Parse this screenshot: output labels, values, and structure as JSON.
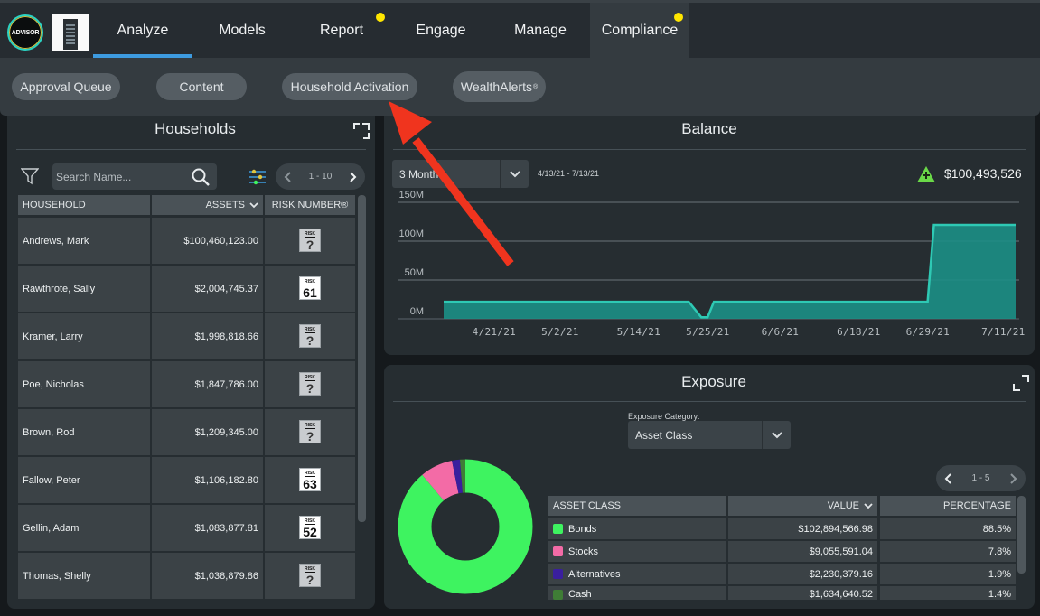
{
  "topbar": {
    "logo_text": "ADVISOR",
    "nav": [
      {
        "label": "Analyze",
        "active": true,
        "dot": false
      },
      {
        "label": "Models",
        "active": false,
        "dot": false
      },
      {
        "label": "Report",
        "active": false,
        "dot": true
      },
      {
        "label": "Engage",
        "active": false,
        "dot": false
      },
      {
        "label": "Manage",
        "active": false,
        "dot": false
      },
      {
        "label": "Compliance",
        "active": false,
        "dot": true,
        "selected": true
      }
    ],
    "dot_color": "#ffe600",
    "accent": "#3d9be0"
  },
  "subnav": {
    "pills": [
      "Approval Queue",
      "Content",
      "Household Activation",
      "WealthAlerts"
    ],
    "wealthalerts_mark": "®"
  },
  "households": {
    "title": "Households",
    "search_placeholder": "Search Name...",
    "pager": "1 - 10",
    "columns": [
      "HOUSEHOLD",
      "ASSETS",
      "RISK NUMBER®"
    ],
    "rows": [
      {
        "name": "Andrews, Mark",
        "assets": "$100,460,123.00",
        "risk": "?"
      },
      {
        "name": "Rawthrote, Sally",
        "assets": "$2,004,745.37",
        "risk": "61"
      },
      {
        "name": "Kramer, Larry",
        "assets": "$1,998,818.66",
        "risk": "?"
      },
      {
        "name": "Poe, Nicholas",
        "assets": "$1,847,786.00",
        "risk": "?"
      },
      {
        "name": "Brown, Rod",
        "assets": "$1,209,345.00",
        "risk": "?"
      },
      {
        "name": "Fallow, Peter",
        "assets": "$1,106,182.80",
        "risk": "63"
      },
      {
        "name": "Gellin, Adam",
        "assets": "$1,083,877.81",
        "risk": "52"
      },
      {
        "name": "Thomas, Shelly",
        "assets": "$1,038,879.86",
        "risk": "?"
      }
    ],
    "risk_badge_label": "RISK"
  },
  "balance": {
    "title": "Balance",
    "range_select": "3 Month",
    "date_range": "4/13/21 - 7/13/21",
    "total": "$100,493,526",
    "chart_color": "#2ec9b4"
  },
  "chart_data": {
    "type": "area",
    "title": "",
    "xlabel": "",
    "ylabel": "",
    "x": [
      "4/13/21",
      "4/21/21",
      "5/2/21",
      "5/14/21",
      "5/22/21",
      "5/24/21",
      "5/25/21",
      "5/26/21",
      "5/28/21",
      "6/6/21",
      "6/18/21",
      "6/28/21",
      "6/29/21",
      "6/30/21",
      "7/13/21"
    ],
    "values": [
      22,
      22,
      22,
      22,
      22,
      2,
      2,
      22,
      22,
      22,
      22,
      22,
      22,
      121,
      121
    ],
    "y_unit": "M",
    "ylim": [
      0,
      150
    ],
    "yticks": [
      "0M",
      "50M",
      "100M",
      "150M"
    ],
    "xticks": [
      "4/21/21",
      "5/2/21",
      "5/14/21",
      "5/25/21",
      "6/6/21",
      "6/18/21",
      "6/29/21",
      "7/11/21"
    ],
    "grid": true
  },
  "exposure": {
    "title": "Exposure",
    "category_label": "Exposure Category:",
    "category_value": "Asset Class",
    "pager": "1 - 5",
    "columns": [
      "ASSET CLASS",
      "VALUE",
      "PERCENTAGE"
    ],
    "rows": [
      {
        "name": "Bonds",
        "value": "$102,894,566.98",
        "pct": "88.5%",
        "color": "#3ef360",
        "share": 88.5
      },
      {
        "name": "Stocks",
        "value": "$9,055,591.04",
        "pct": "7.8%",
        "color": "#f36ba6",
        "share": 7.8
      },
      {
        "name": "Alternatives",
        "value": "$2,230,379.16",
        "pct": "1.9%",
        "color": "#3a1f9e",
        "share": 1.9
      },
      {
        "name": "Cash",
        "value": "$1,634,640.52",
        "pct": "1.4%",
        "color": "#3f7d36",
        "share": 1.4
      }
    ]
  }
}
